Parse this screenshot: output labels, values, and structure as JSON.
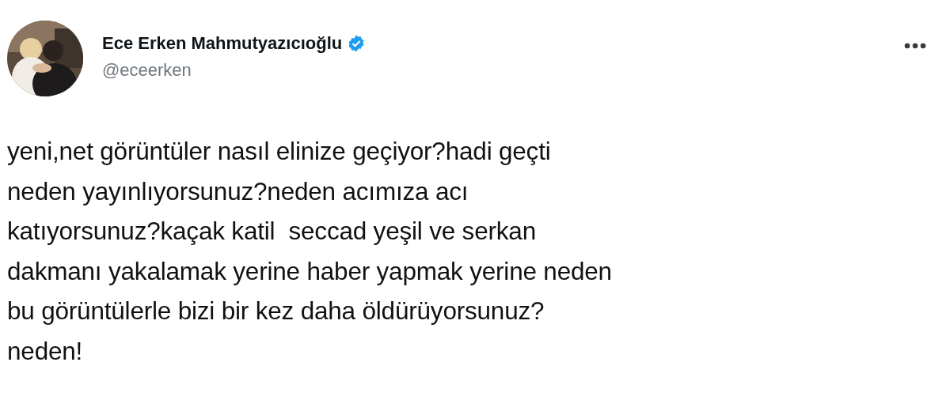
{
  "author": {
    "name": "Ece Erken Mahmutyazıcıoğlu",
    "verified": true,
    "handle": "@eceerken"
  },
  "tweet": {
    "text": "yeni,net görüntüler nasıl elinize geçiyor?hadi geçti\nneden yayınlıyorsunuz?neden acımıza acı\nkatıyorsunuz?kaçak katil  seccad yeşil ve serkan\ndakmanı yakalamak yerine haber yapmak yerine neden\nbu görüntülerle bizi bir kez daha öldürüyorsunuz?\nneden!"
  }
}
